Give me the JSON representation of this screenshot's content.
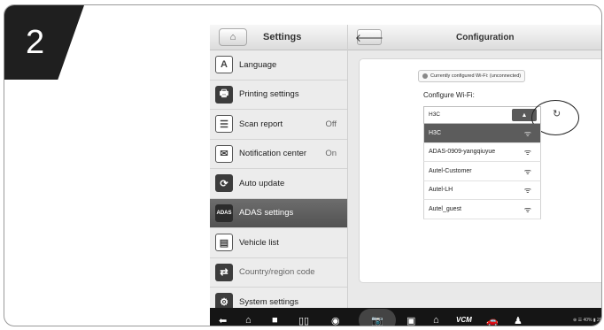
{
  "step": {
    "number": "2"
  },
  "settings": {
    "title": "Settings",
    "items": [
      {
        "label": "Language",
        "value": "",
        "icon": "A"
      },
      {
        "label": "Printing settings",
        "value": "",
        "icon": "🖶"
      },
      {
        "label": "Scan report",
        "value": "Off",
        "icon": "☰"
      },
      {
        "label": "Notification center",
        "value": "On",
        "icon": "✉"
      },
      {
        "label": "Auto update",
        "value": "",
        "icon": "⟳"
      },
      {
        "label": "ADAS settings",
        "value": "",
        "icon": "ADAS"
      },
      {
        "label": "Vehicle list",
        "value": "",
        "icon": "▤"
      },
      {
        "label": "Country/region code",
        "value": "",
        "icon": "⇄"
      },
      {
        "label": "System settings",
        "value": "",
        "icon": "⚙"
      }
    ]
  },
  "config": {
    "title": "Configuration",
    "status": "Currently configured Wi-Fi: (unconnected)",
    "wifi_label": "Configure Wi-Fi:",
    "selected": "H3C",
    "options": [
      "H3C",
      "ADAS-0909-yangqiuyue",
      "Autel-Customer",
      "Autel-LH",
      "Autel_guest"
    ]
  },
  "navbar": {
    "vci_label": "VCM",
    "status_text": "⊕ ☰ 40% ▮ 20"
  }
}
